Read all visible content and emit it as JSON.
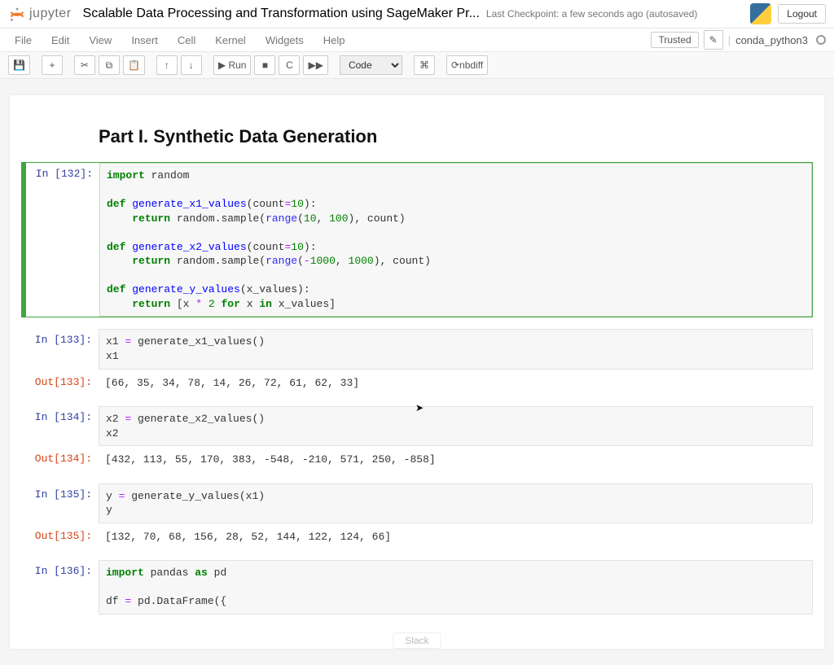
{
  "header": {
    "logo_text": "jupyter",
    "title": "Scalable Data Processing and Transformation using SageMaker Pr...",
    "checkpoint": "Last Checkpoint: a few seconds ago",
    "autosaved": "(autosaved)",
    "logout": "Logout"
  },
  "menubar": {
    "items": [
      "File",
      "Edit",
      "View",
      "Insert",
      "Cell",
      "Kernel",
      "Widgets",
      "Help"
    ],
    "trusted": "Trusted",
    "kernel": "conda_python3"
  },
  "toolbar": {
    "save_icon": "💾",
    "add_icon": "+",
    "cut_icon": "✂",
    "copy_icon": "⧉",
    "paste_icon": "📋",
    "up_icon": "↑",
    "down_icon": "↓",
    "run_label": "▶ Run",
    "stop_icon": "■",
    "restart_icon": "C",
    "ff_icon": "▶▶",
    "celltype": "Code",
    "cmd_icon": "⌘",
    "nbdiff_label": "nbdiff"
  },
  "markdown": {
    "h2": "Part I. Synthetic Data Generation"
  },
  "cells": [
    {
      "id": 132,
      "in_prompt": "In [132]:",
      "code_tokens": [
        [
          "kw",
          "import"
        ],
        [
          "plain",
          " random\n\n"
        ],
        [
          "kw",
          "def"
        ],
        [
          "plain",
          " "
        ],
        [
          "fn",
          "generate_x1_values"
        ],
        [
          "plain",
          "(count"
        ],
        [
          "op",
          "="
        ],
        [
          "num",
          "10"
        ],
        [
          "plain",
          "):\n    "
        ],
        [
          "kw",
          "return"
        ],
        [
          "plain",
          " random.sample("
        ],
        [
          "nm",
          "range"
        ],
        [
          "plain",
          "("
        ],
        [
          "num",
          "10"
        ],
        [
          "plain",
          ", "
        ],
        [
          "num",
          "100"
        ],
        [
          "plain",
          "), count)\n\n"
        ],
        [
          "kw",
          "def"
        ],
        [
          "plain",
          " "
        ],
        [
          "fn",
          "generate_x2_values"
        ],
        [
          "plain",
          "(count"
        ],
        [
          "op",
          "="
        ],
        [
          "num",
          "10"
        ],
        [
          "plain",
          "):\n    "
        ],
        [
          "kw",
          "return"
        ],
        [
          "plain",
          " random.sample("
        ],
        [
          "nm",
          "range"
        ],
        [
          "plain",
          "("
        ],
        [
          "op",
          "-"
        ],
        [
          "num",
          "1000"
        ],
        [
          "plain",
          ", "
        ],
        [
          "num",
          "1000"
        ],
        [
          "plain",
          "), count)\n\n"
        ],
        [
          "kw",
          "def"
        ],
        [
          "plain",
          " "
        ],
        [
          "fn",
          "generate_y_values"
        ],
        [
          "plain",
          "(x_values):\n    "
        ],
        [
          "kw",
          "return"
        ],
        [
          "plain",
          " [x "
        ],
        [
          "op",
          "*"
        ],
        [
          "plain",
          " "
        ],
        [
          "num",
          "2"
        ],
        [
          "plain",
          " "
        ],
        [
          "kw",
          "for"
        ],
        [
          "plain",
          " x "
        ],
        [
          "kw",
          "in"
        ],
        [
          "plain",
          " x_values]"
        ]
      ],
      "selected": true
    },
    {
      "id": 133,
      "in_prompt": "In [133]:",
      "code_tokens": [
        [
          "plain",
          "x1 "
        ],
        [
          "op",
          "="
        ],
        [
          "plain",
          " generate_x1_values()\nx1"
        ]
      ],
      "out_prompt": "Out[133]:",
      "output": "[66, 35, 34, 78, 14, 26, 72, 61, 62, 33]"
    },
    {
      "id": 134,
      "in_prompt": "In [134]:",
      "code_tokens": [
        [
          "plain",
          "x2 "
        ],
        [
          "op",
          "="
        ],
        [
          "plain",
          " generate_x2_values()\nx2"
        ]
      ],
      "out_prompt": "Out[134]:",
      "output": "[432, 113, 55, 170, 383, -548, -210, 571, 250, -858]"
    },
    {
      "id": 135,
      "in_prompt": "In [135]:",
      "code_tokens": [
        [
          "plain",
          "y "
        ],
        [
          "op",
          "="
        ],
        [
          "plain",
          " generate_y_values(x1)\ny"
        ]
      ],
      "out_prompt": "Out[135]:",
      "output": "[132, 70, 68, 156, 28, 52, 144, 122, 124, 66]"
    },
    {
      "id": 136,
      "in_prompt": "In [136]:",
      "code_tokens": [
        [
          "kw",
          "import"
        ],
        [
          "plain",
          " pandas "
        ],
        [
          "kw",
          "as"
        ],
        [
          "plain",
          " pd\n\ndf "
        ],
        [
          "op",
          "="
        ],
        [
          "plain",
          " pd.DataFrame({"
        ]
      ]
    }
  ],
  "extras": {
    "slack": "Slack"
  }
}
